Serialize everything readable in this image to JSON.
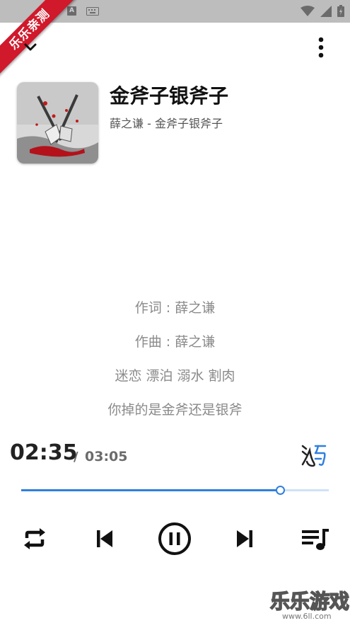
{
  "watermark_ribbon": "乐乐亲测",
  "now_playing": {
    "title": "金斧子银斧子",
    "subtitle": "薛之谦 - 金斧子银斧子"
  },
  "lyrics": [
    "作词 : 薛之谦",
    "作曲 : 薛之谦",
    "迷恋 漂泊 溺水 割肉",
    "你掉的是金斧还是银斧"
  ],
  "playback": {
    "current_time": "02:35",
    "separator": "/",
    "total_time": "03:05",
    "progress": 0.838
  },
  "icons": {
    "collapse": "chevron-down-icon",
    "more": "more-vertical-icon",
    "lyrics": "lyrics-toggle-icon",
    "repeat": "repeat-icon",
    "previous": "skip-previous-icon",
    "pause": "pause-circle-icon",
    "next": "skip-next-icon",
    "queue": "playlist-icon"
  },
  "colors": {
    "accent": "#2f7fe0",
    "ribbon": "#d0192b"
  },
  "watermark_footer": {
    "brand": "乐乐游戏",
    "url": "www.6ll.com"
  }
}
